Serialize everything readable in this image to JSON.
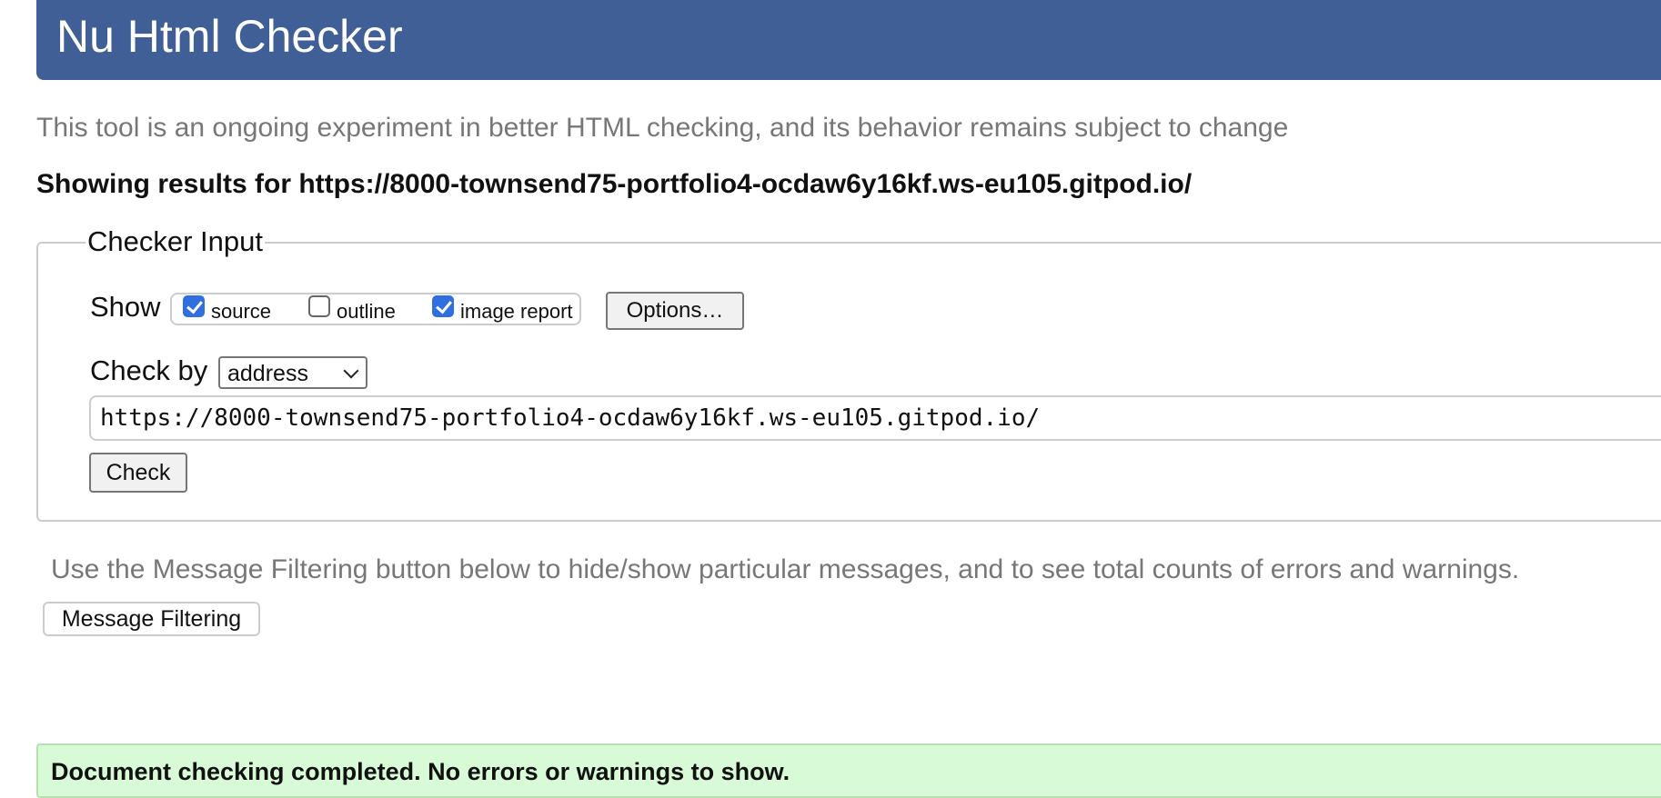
{
  "header": {
    "title": "Nu Html Checker",
    "color": "#3f5f96"
  },
  "intro": {
    "tagline": "This tool is an ongoing experiment in better HTML checking, and its behavior remains subject to change",
    "results_for": "Showing results for https://8000-townsend75-portfolio4-ocdaw6y16kf.ws-eu105.gitpod.io/"
  },
  "checker_input": {
    "legend": "Checker Input",
    "show_label": "Show",
    "options": [
      {
        "label": "source",
        "checked": true
      },
      {
        "label": "outline",
        "checked": false
      },
      {
        "label": "image report",
        "checked": true
      }
    ],
    "options_button": "Options…",
    "check_by_label": "Check by",
    "check_by_selected": "address",
    "url_value": "https://8000-townsend75-portfolio4-ocdaw6y16kf.ws-eu105.gitpod.io/",
    "check_button": "Check"
  },
  "filtering": {
    "hint": "Use the Message Filtering button below to hide/show particular messages, and to see total counts of errors and warnings.",
    "button": "Message Filtering"
  },
  "result": {
    "message": "Document checking completed. No errors or warnings to show.",
    "color": "#d9fad6"
  }
}
